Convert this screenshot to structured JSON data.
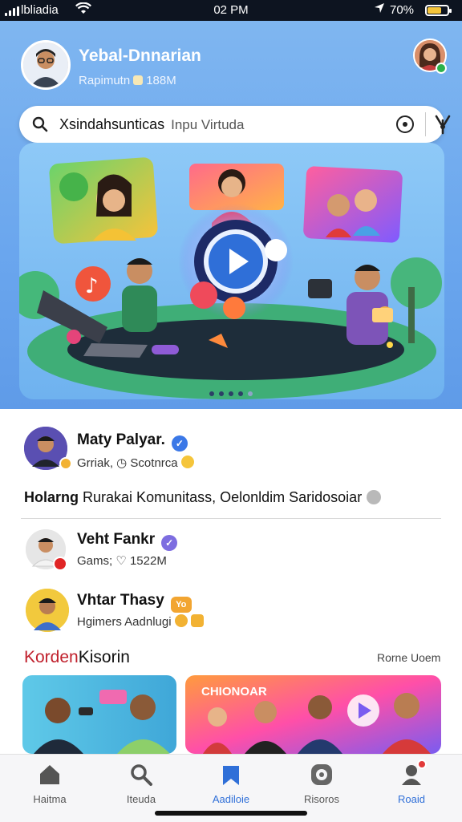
{
  "status_bar": {
    "carrier": "lbliadia",
    "time": "02 PM",
    "battery": "70%",
    "battery_level": 0.7
  },
  "header": {
    "name": "Yebal-Dnnarian",
    "subtitle_left": "Rapimutn",
    "subtitle_right": "188M"
  },
  "search": {
    "value": "Xsindahsunticas",
    "placeholder": "Inpu Virtuda"
  },
  "banner": {
    "slides": 5,
    "active_slide": 4
  },
  "feed": [
    {
      "name": "Maty Palyar.",
      "sub": "Grriak, ◷ Scotnrca",
      "verified_color": "#3b78e7",
      "ring": "#f2b233"
    },
    {
      "name": "Veht Fankr",
      "sub": "Gams; ♡ 1522M",
      "verified_color": "#7d6de0",
      "ring": "#e02525"
    },
    {
      "name": "Vhtar Thasy",
      "sub": "Hgimers Aadnlugi",
      "verified_color": "#f2a531",
      "verified_text": "Yo",
      "ring": "#f2b233"
    }
  ],
  "caption": {
    "bold": "Holarng",
    "text": "Rurakai Komunitass, Oelonldim Saridosoiar"
  },
  "section": {
    "title_red": "Korden",
    "title_rest": "Kisorin",
    "more": "Rorne Uoem",
    "card_title": "CHIONOAR"
  },
  "tabs": [
    {
      "label": "Haitma",
      "icon": "home-icon"
    },
    {
      "label": "Iteuda",
      "icon": "search-icon"
    },
    {
      "label": "Aadiloie",
      "icon": "bookmark-icon",
      "active": true
    },
    {
      "label": "Risoros",
      "icon": "mood-icon"
    },
    {
      "label": "Roaid",
      "icon": "profile-icon"
    }
  ],
  "colors": {
    "accent": "#2f6fd8",
    "header_bg": "#6aa6ee",
    "status_bar": "#0d1420"
  }
}
